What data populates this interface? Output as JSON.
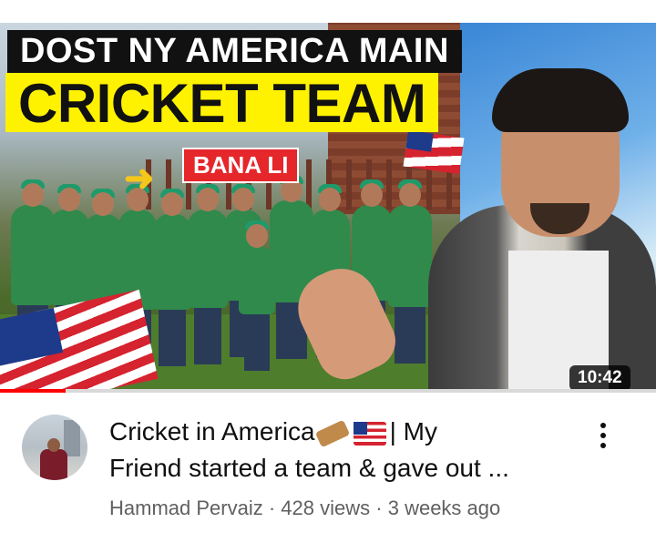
{
  "thumbnail": {
    "line1": "DOST NY AMERICA MAIN",
    "line2": "CRICKET TEAM",
    "line3": "BANA LI",
    "duration": "10:42",
    "watch_progress": 0.1
  },
  "video": {
    "title_line1": "Cricket in America",
    "title_line1_suffix": "| My",
    "title_line2": "Friend started a team & gave out ...",
    "channel": "Hammad Pervaiz",
    "separator": "·",
    "views": "428 views",
    "age": "3 weeks ago"
  },
  "icons": {
    "cricket": "cricket-bat-icon",
    "flag": "us-flag-icon",
    "menu": "more-vertical-icon"
  },
  "colors": {
    "progress": "#ff0000",
    "title_highlight": "#fff200",
    "badge_red": "#e5262b"
  }
}
